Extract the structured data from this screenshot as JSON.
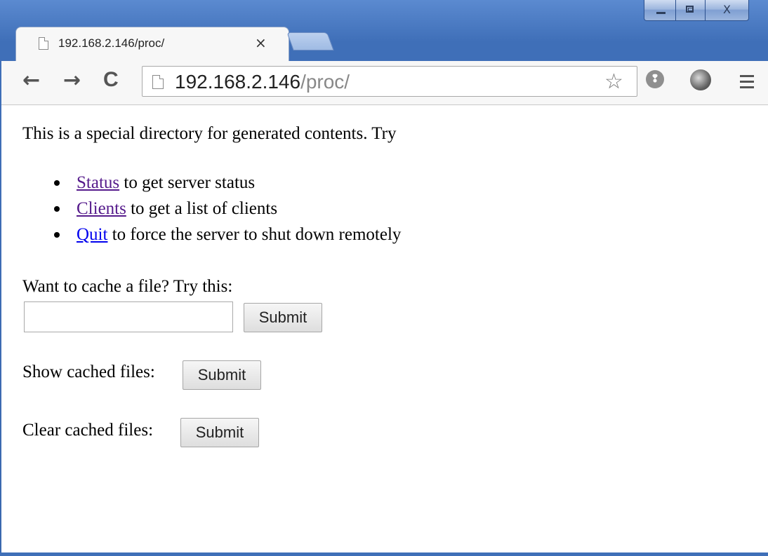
{
  "window": {
    "controls": {
      "minimize": "—",
      "maximize": "□",
      "close": "X"
    }
  },
  "tab": {
    "title": "192.168.2.146/proc/",
    "close": "×"
  },
  "toolbar": {
    "back": "←",
    "forward": "→",
    "reload": "C",
    "url_host": "192.168.2.146",
    "url_path": "/proc/",
    "star": "☆",
    "ext1_glyph": "❢"
  },
  "page": {
    "intro": "This is a special directory for generated contents. Try",
    "links": [
      {
        "link": "Status",
        "rest": " to get server status"
      },
      {
        "link": "Clients",
        "rest": " to get a list of clients"
      },
      {
        "link": "Quit",
        "rest": " to force the server to shut down remotely"
      }
    ],
    "cache_label": "Want to cache a file? Try this:",
    "cache_input_value": "",
    "submit": "Submit",
    "show_label": "Show cached files:",
    "clear_label": "Clear cached files:"
  }
}
